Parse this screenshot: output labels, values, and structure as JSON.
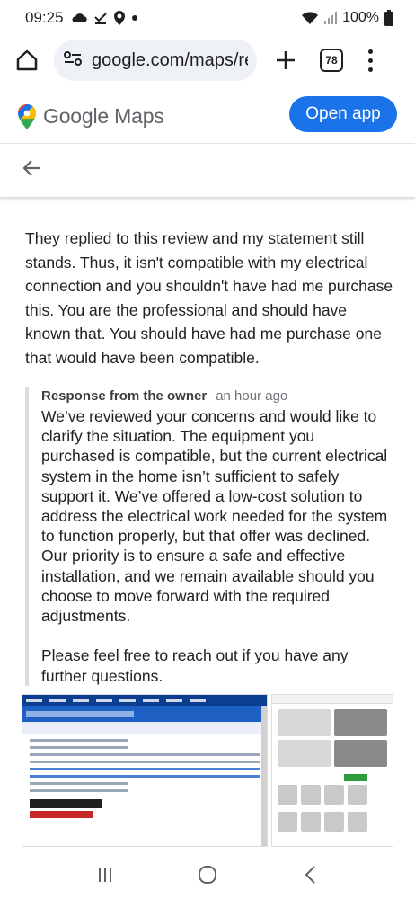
{
  "status_bar": {
    "time": "09:25",
    "battery": "100%",
    "icons": [
      "cloud-icon",
      "check-download-icon",
      "location-icon",
      "dot-icon",
      "wifi-icon",
      "signal-icon",
      "battery-icon"
    ]
  },
  "browser": {
    "url": "google.com/maps/re",
    "tab_count": "78"
  },
  "maps_header": {
    "title": "Google Maps",
    "open_app_label": "Open app",
    "accent": "#1a73e8"
  },
  "review": {
    "text": "They replied to this review and my statement still stands. Thus, it isn't compatible with my electrical connection and you shouldn't have had me purchase this. You are the professional and should have known that. You should have had me purchase one that would have been compatible."
  },
  "owner_response": {
    "label": "Response from the owner",
    "time": "an hour ago",
    "text": "We’ve reviewed your concerns and would like to clarify the situation. The equipment you purchased is compatible, but the current electrical system in the home isn’t sufficient to safely support it. We’ve offered a low-cost solution to address the electrical work needed for the system to function properly, but that offer was declined. Our priority is to ensure a safe and effective installation, and we remain available should you choose to move forward with the required adjustments.\n\nPlease feel free to reach out if you have any further questions."
  },
  "photos": [
    {
      "name": "email-screenshot-photo"
    },
    {
      "name": "product-listing-photo"
    }
  ]
}
